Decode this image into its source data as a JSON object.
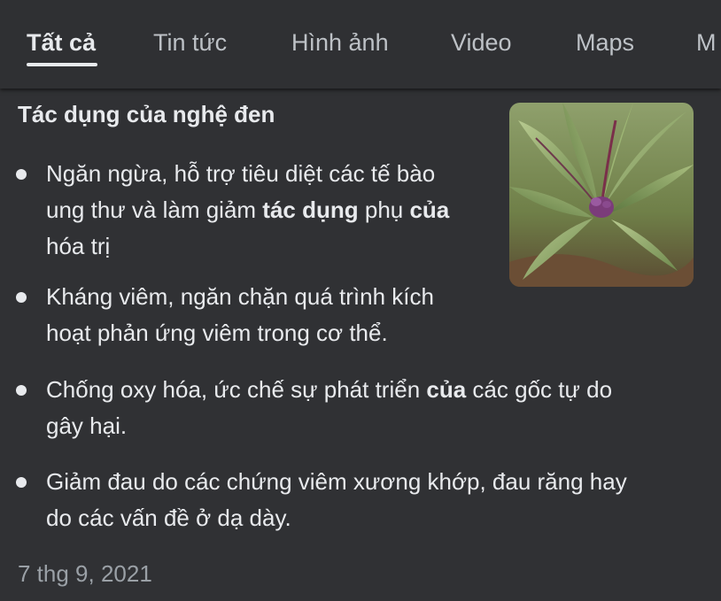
{
  "tabs": [
    {
      "label": "Tất cả",
      "active": true
    },
    {
      "label": "Tin tức",
      "active": false
    },
    {
      "label": "Hình ảnh",
      "active": false
    },
    {
      "label": "Video",
      "active": false
    },
    {
      "label": "Maps",
      "active": false
    },
    {
      "label": "M",
      "active": false
    }
  ],
  "snippet": {
    "title": "Tác dụng của nghệ đen",
    "bullets": [
      {
        "parts": [
          "Ngăn ngừa, hỗ trợ tiêu diệt các tế bào",
          "ung thư và làm giảm ",
          "tác dụng",
          " phụ ",
          "của",
          "hóa trị"
        ]
      },
      {
        "parts": [
          "Kháng viêm, ngăn chặn quá trình kích",
          "hoạt phản ứng viêm trong cơ thể."
        ]
      },
      {
        "parts": [
          "Chống oxy hóa, ức chế sự phát triển ",
          "của",
          " các gốc tự do",
          "gây hại."
        ]
      },
      {
        "parts": [
          "Giảm đau do các chứng viêm xương khớp, đau răng hay",
          "do các vấn đề ở dạ dày."
        ]
      }
    ],
    "date": "7 thg 9, 2021",
    "image_subject": "black turmeric plant"
  },
  "colors": {
    "background": "#303134",
    "text": "#e8eaed",
    "muted": "#9aa0a6"
  }
}
